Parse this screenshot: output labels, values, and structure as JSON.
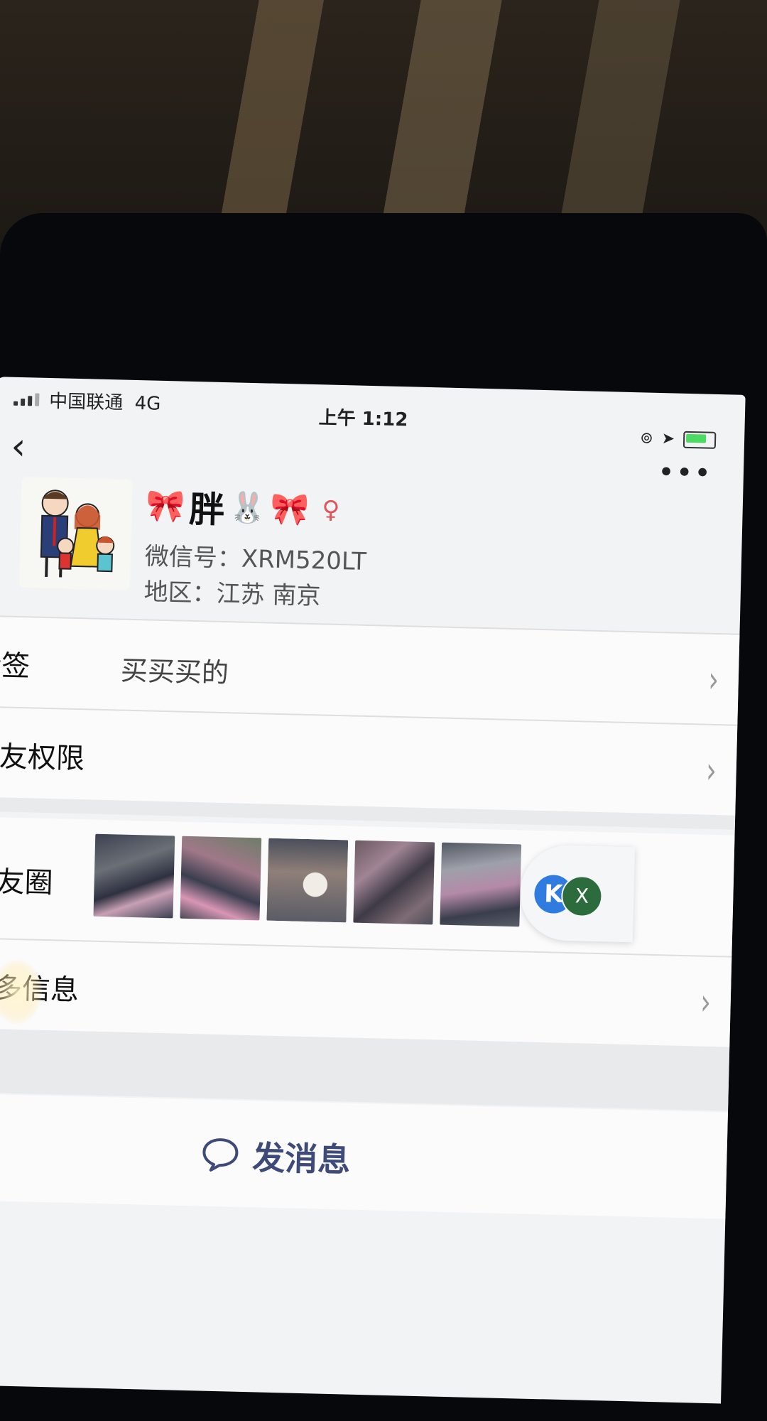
{
  "status_bar": {
    "carrier": "中国联通",
    "network": "4G",
    "time": "上午 1:12"
  },
  "profile": {
    "nickname": "胖",
    "wechat_id_label": "微信号：XRM520LT",
    "region_label": "地区：江苏 南京"
  },
  "rows": {
    "tags_label": "标签",
    "tags_value": "买买买的",
    "permissions_label": "朋友权限",
    "moments_label": "朋友圈",
    "more_info_label": "更多信息"
  },
  "message_button": {
    "label": "发消息"
  },
  "float_badge": {
    "k": "K",
    "x": "X"
  },
  "icons": {
    "back": "chevron-left-icon",
    "more": "ellipsis-icon",
    "chevron": "chevron-right-icon",
    "chat": "chat-bubble-icon"
  }
}
